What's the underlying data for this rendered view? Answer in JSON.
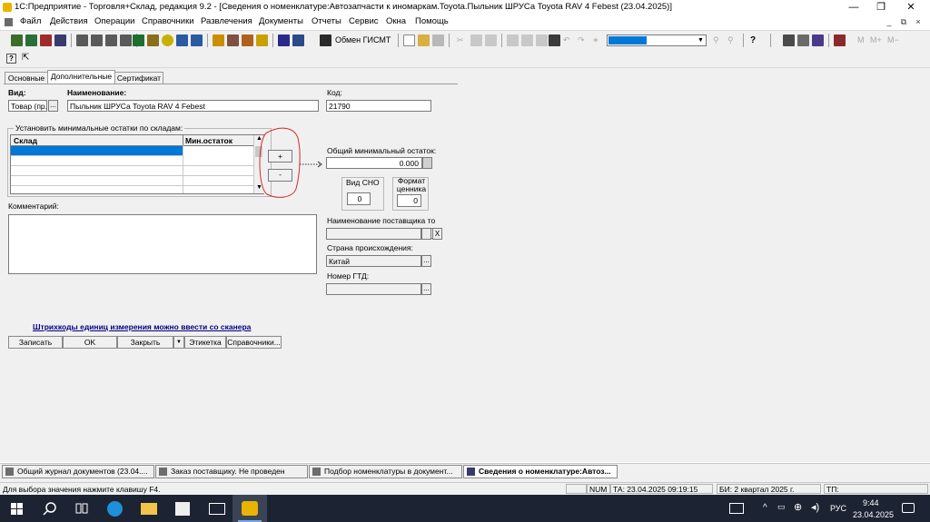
{
  "window": {
    "title": "1С:Предприятие - Торговля+Склад, редакция 9.2 - [Сведения о номенклатуре:Автозапчасти к иномаркам.Toyota.Пыльник ШРУСа Toyota RAV 4 Febest (23.04.2025)]",
    "minimize": "—",
    "restore": "❐",
    "close": "✕"
  },
  "menu": [
    "Файл",
    "Действия",
    "Операции",
    "Справочники",
    "Развлечения",
    "Документы",
    "Отчеты",
    "Сервис",
    "Окна",
    "Помощь"
  ],
  "mdi_controls": [
    "_",
    "⧉",
    "×"
  ],
  "toolbar": {
    "exchange_label": "Обмен ГИСМТ",
    "m_buttons": [
      "M",
      "M+",
      "M−"
    ],
    "help_icon": "?",
    "find_icon": "⊞"
  },
  "tabs": [
    "Основные",
    "Дополнительные",
    "Сертификат"
  ],
  "form": {
    "vid_label": "Вид:",
    "vid_value": "Товар (пр.",
    "name_label": "Наименование:",
    "name_value": "Пыльник ШРУСа Toyota RAV 4 Febest",
    "code_label": "Код:",
    "code_value": "21790",
    "min_stock_group": "Установить минимальные остатки по складам:",
    "grid_columns": [
      "Склад",
      "Мин.остаток"
    ],
    "plus_button": "+",
    "minus_button": "-",
    "total_min_label": "Общий минимальный остаток:",
    "total_min_value": "0.000",
    "sno_label": "Вид СНО",
    "sno_value": "0",
    "price_format_label": "Формат ценника",
    "price_format_value": "0",
    "comment_label": "Комментарий:",
    "supplier_label": "Наименование поставщика то",
    "supplier_value": "",
    "clear_button": "X",
    "country_label": "Страна происхождения:",
    "country_value": "Китай",
    "gtd_label": "Номер ГТД:",
    "gtd_value": "",
    "ellipsis": "...",
    "barcode_link": "Штрихкоды единиц измерения можно ввести со сканера"
  },
  "buttons": {
    "save": "Записать",
    "ok": "OK",
    "close": "Закрыть",
    "close_arrow": "▼",
    "label": "Этикетка",
    "refs": "Справочники..."
  },
  "mdi_tasks": [
    "Общий журнал документов (23.04....",
    "Заказ поставщику. Не проведен",
    "Подбор номенклатуры в документ...",
    "Сведения о номенклатуре:Автоз..."
  ],
  "status": {
    "hint": "Для выбора значения нажмите клавишу F4.",
    "num": "NUM",
    "ta": "ТА: 23.04.2025  09:19:15",
    "bi": "БИ: 2 квартал 2025 г.",
    "tp": "ТП:"
  },
  "os_taskbar": {
    "lang": "РУС",
    "time": "9:44",
    "date": "23.04.2025"
  },
  "colors": {
    "selection": "#0078d7",
    "annotation": "#d62828",
    "link": "#000080",
    "taskbar": "#1c2333"
  }
}
